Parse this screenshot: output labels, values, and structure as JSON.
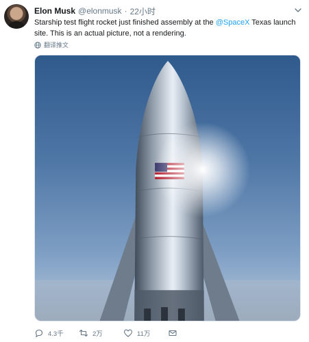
{
  "author": {
    "name": "Elon Musk",
    "handle": "@elonmusk",
    "separator": "·",
    "time": "22小时"
  },
  "tweet": {
    "text_before": "Starship test flight rocket just finished assembly at the ",
    "mention": "@SpaceX",
    "text_after": " Texas launch site. This is an actual picture, not a rendering.",
    "translate_label": "翻译推文"
  },
  "actions": {
    "reply_count": "4.3千",
    "retweet_count": "2万",
    "like_count": "11万"
  },
  "colors": {
    "accent": "#1da1f2",
    "muted": "#657786"
  },
  "icons": [
    "avatar",
    "chevron-down-icon",
    "globe-icon",
    "reply-icon",
    "retweet-icon",
    "like-icon",
    "mail-icon"
  ]
}
